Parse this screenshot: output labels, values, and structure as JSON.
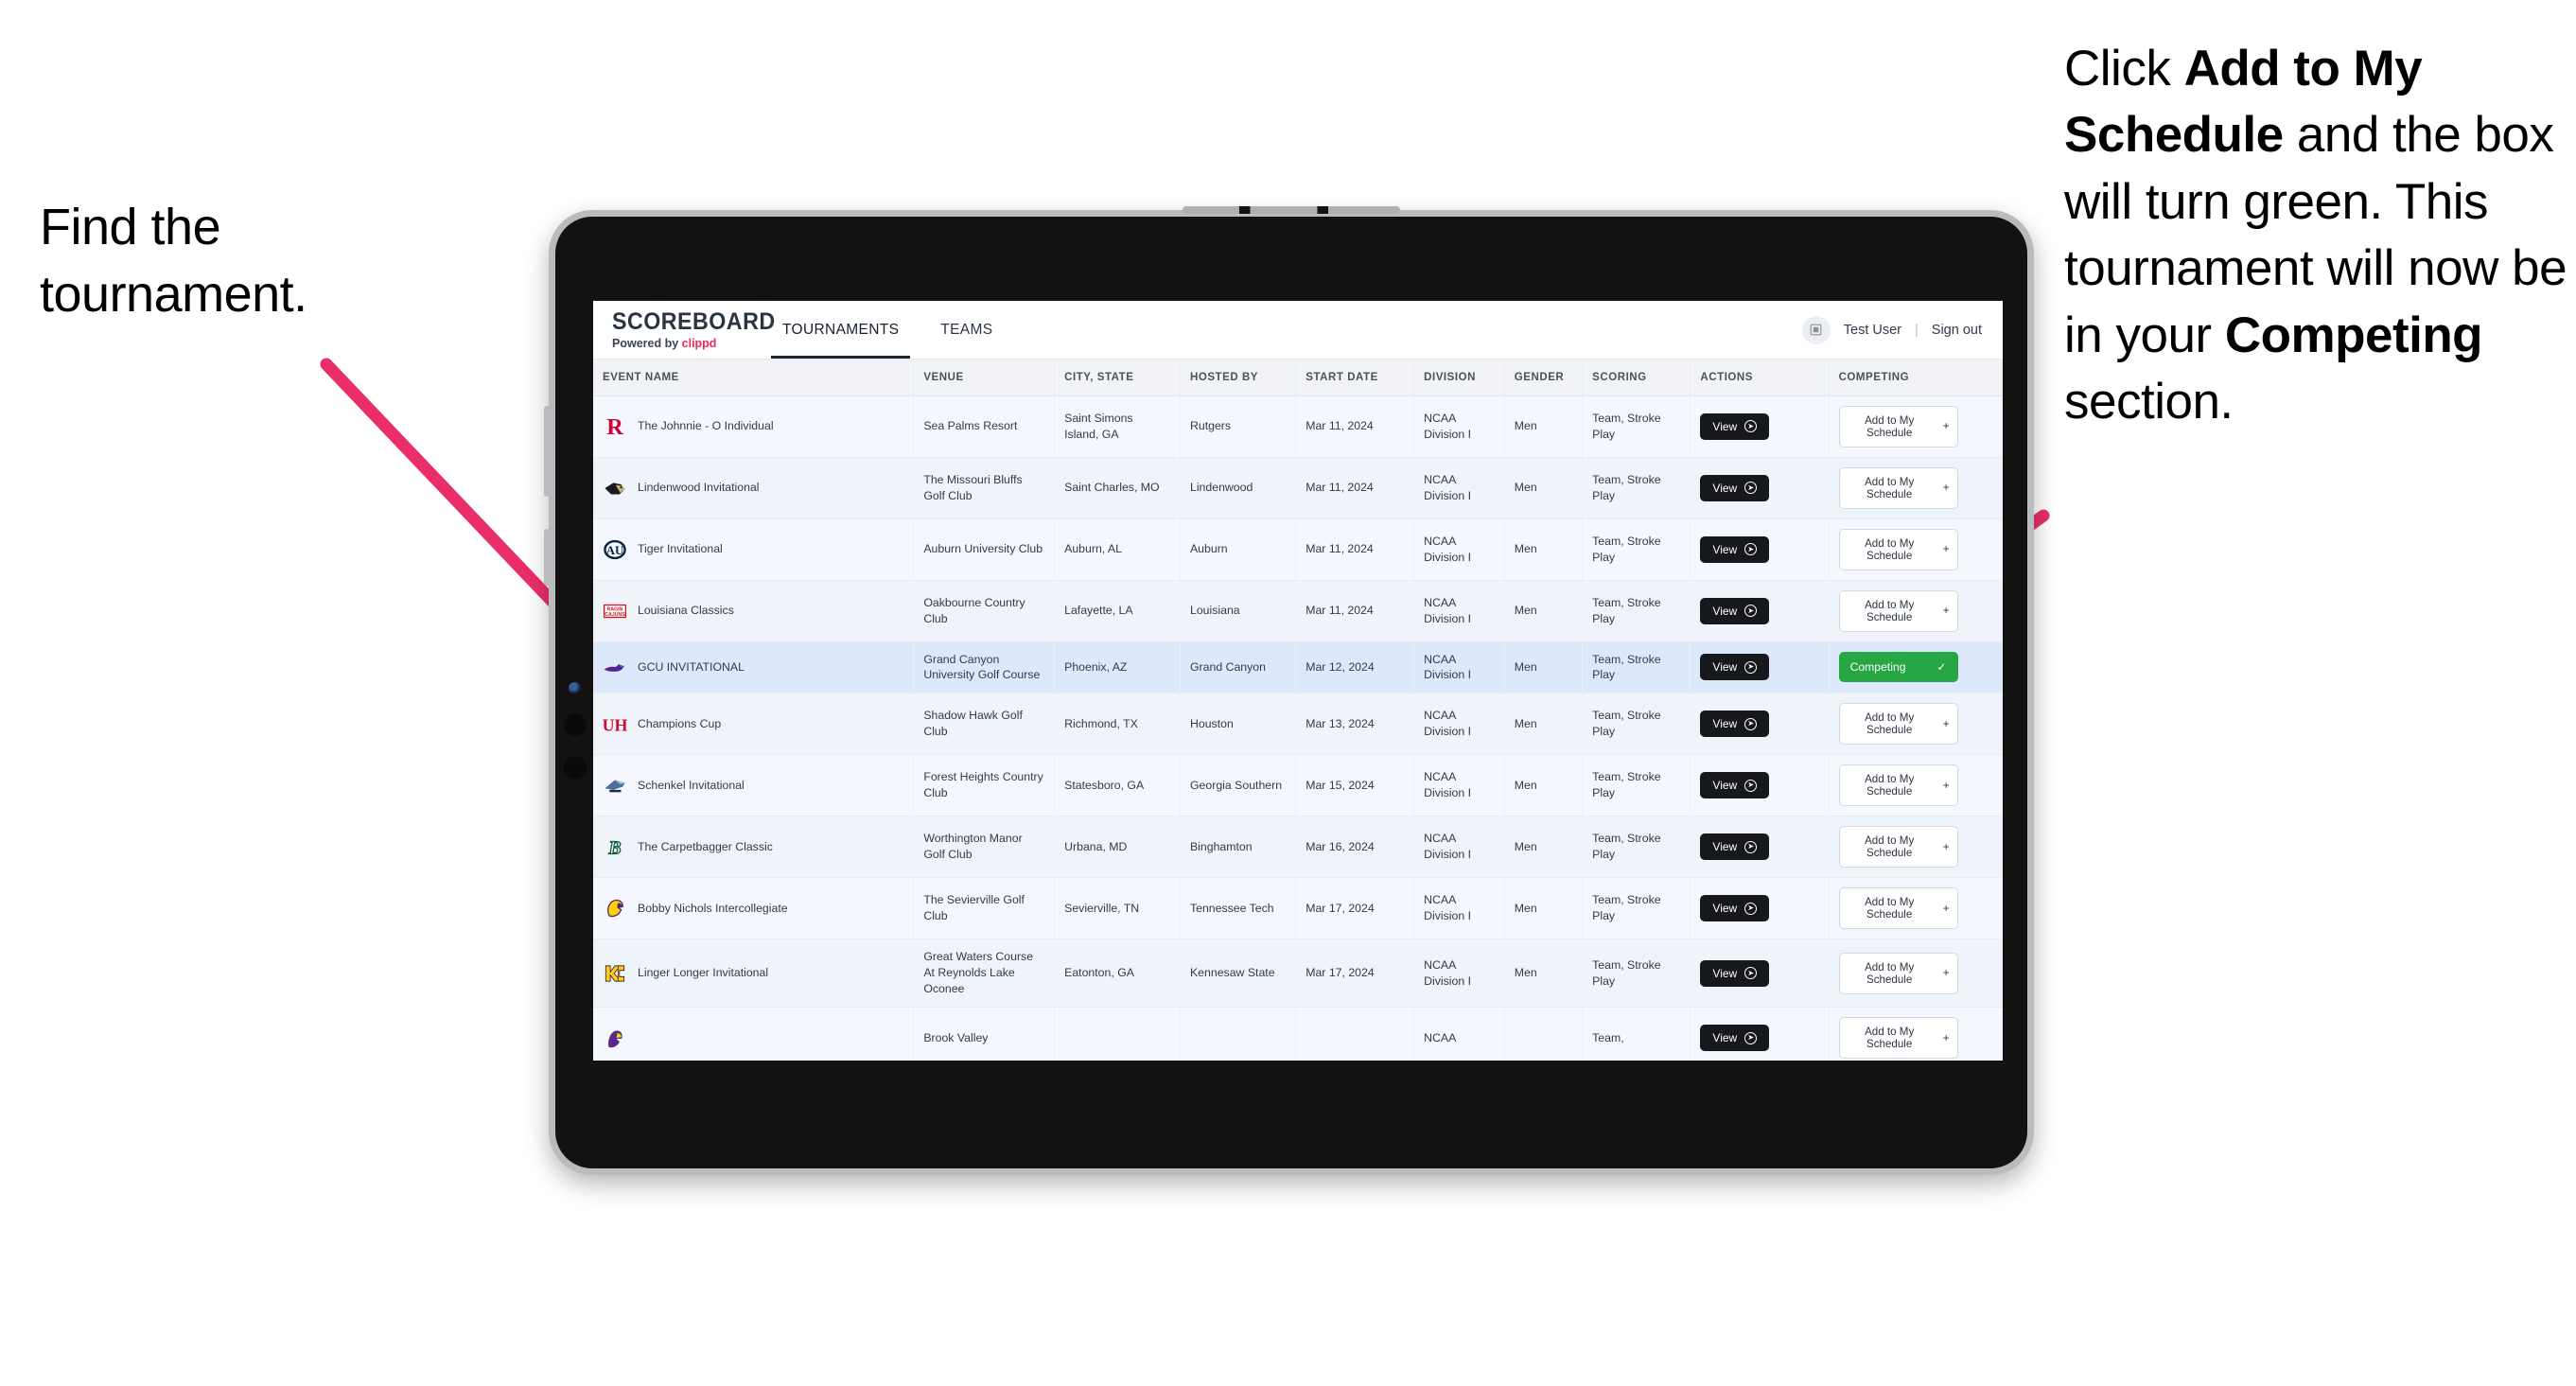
{
  "annotations": {
    "left": {
      "line1": "Find the",
      "line2": "tournament."
    },
    "right": {
      "seg1": "Click ",
      "bold1": "Add to My Schedule",
      "seg2": " and the box will turn green. This tournament will now be in your ",
      "bold2": "Competing",
      "seg3": " section."
    },
    "arrow_color": "#ea2f68"
  },
  "app": {
    "brand": {
      "title": "SCOREBOARD",
      "powered_prefix": "Powered by ",
      "powered_brand": "clippd"
    },
    "nav": [
      {
        "label": "TOURNAMENTS",
        "active": true
      },
      {
        "label": "TEAMS",
        "active": false
      }
    ],
    "user": {
      "avatar_icon": "user-badge-icon",
      "name": "Test User",
      "separator": "|",
      "sign_out": "Sign out"
    },
    "table": {
      "columns": [
        "EVENT NAME",
        "VENUE",
        "CITY, STATE",
        "HOSTED BY",
        "START DATE",
        "DIVISION",
        "GENDER",
        "SCORING",
        "ACTIONS",
        "COMPETING"
      ],
      "action_label": "View",
      "add_label": "Add to My Schedule",
      "add_icon": "plus-icon",
      "competing_label": "Competing",
      "competing_icon": "check-icon",
      "competing_color": "#27a744",
      "rows": [
        {
          "logo": "rutgers-logo",
          "event": "The Johnnie - O Individual",
          "venue": "Sea Palms Resort",
          "city": "Saint Simons Island, GA",
          "host": "Rutgers",
          "date": "Mar 11, 2024",
          "division": "NCAA Division I",
          "gender": "Men",
          "scoring": "Team, Stroke Play",
          "competing": false
        },
        {
          "logo": "lindenwood-logo",
          "event": "Lindenwood Invitational",
          "venue": "The Missouri Bluffs Golf Club",
          "city": "Saint Charles, MO",
          "host": "Lindenwood",
          "date": "Mar 11, 2024",
          "division": "NCAA Division I",
          "gender": "Men",
          "scoring": "Team, Stroke Play",
          "competing": false
        },
        {
          "logo": "auburn-logo",
          "event": "Tiger Invitational",
          "venue": "Auburn University Club",
          "city": "Auburn, AL",
          "host": "Auburn",
          "date": "Mar 11, 2024",
          "division": "NCAA Division I",
          "gender": "Men",
          "scoring": "Team, Stroke Play",
          "competing": false
        },
        {
          "logo": "louisiana-logo",
          "event": "Louisiana Classics",
          "venue": "Oakbourne Country Club",
          "city": "Lafayette, LA",
          "host": "Louisiana",
          "date": "Mar 11, 2024",
          "division": "NCAA Division I",
          "gender": "Men",
          "scoring": "Team, Stroke Play",
          "competing": false
        },
        {
          "logo": "gcu-logo",
          "event": "GCU INVITATIONAL",
          "venue": "Grand Canyon University Golf Course",
          "city": "Phoenix, AZ",
          "host": "Grand Canyon",
          "date": "Mar 12, 2024",
          "division": "NCAA Division I",
          "gender": "Men",
          "scoring": "Team, Stroke Play",
          "competing": true,
          "selected": true
        },
        {
          "logo": "houston-logo",
          "event": "Champions Cup",
          "venue": "Shadow Hawk Golf Club",
          "city": "Richmond, TX",
          "host": "Houston",
          "date": "Mar 13, 2024",
          "division": "NCAA Division I",
          "gender": "Men",
          "scoring": "Team, Stroke Play",
          "competing": false
        },
        {
          "logo": "georgia-southern-logo",
          "event": "Schenkel Invitational",
          "venue": "Forest Heights Country Club",
          "city": "Statesboro, GA",
          "host": "Georgia Southern",
          "date": "Mar 15, 2024",
          "division": "NCAA Division I",
          "gender": "Men",
          "scoring": "Team, Stroke Play",
          "competing": false
        },
        {
          "logo": "binghamton-logo",
          "event": "The Carpetbagger Classic",
          "venue": "Worthington Manor Golf Club",
          "city": "Urbana, MD",
          "host": "Binghamton",
          "date": "Mar 16, 2024",
          "division": "NCAA Division I",
          "gender": "Men",
          "scoring": "Team, Stroke Play",
          "competing": false
        },
        {
          "logo": "tennessee-tech-logo",
          "event": "Bobby Nichols Intercollegiate",
          "venue": "The Sevierville Golf Club",
          "city": "Sevierville, TN",
          "host": "Tennessee Tech",
          "date": "Mar 17, 2024",
          "division": "NCAA Division I",
          "gender": "Men",
          "scoring": "Team, Stroke Play",
          "competing": false
        },
        {
          "logo": "kennesaw-logo",
          "event": "Linger Longer Invitational",
          "venue": "Great Waters Course At Reynolds Lake Oconee",
          "city": "Eatonton, GA",
          "host": "Kennesaw State",
          "date": "Mar 17, 2024",
          "division": "NCAA Division I",
          "gender": "Men",
          "scoring": "Team, Stroke Play",
          "competing": false
        },
        {
          "logo": "ecu-logo",
          "event": "",
          "venue": "Brook Valley",
          "city": "",
          "host": "",
          "date": "",
          "division": "NCAA",
          "gender": "",
          "scoring": "Team,",
          "competing": false,
          "partial": true
        }
      ]
    }
  }
}
